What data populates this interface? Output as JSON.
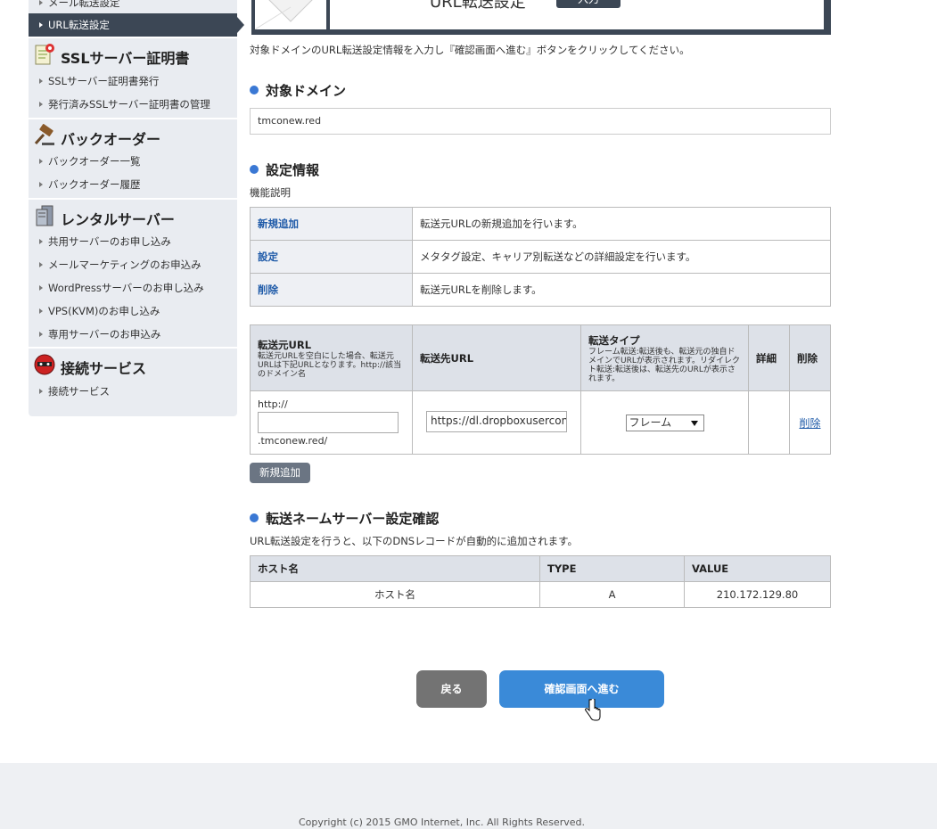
{
  "sidebar": {
    "top_item": "メール転送設定",
    "active_item": "URL転送設定",
    "sections": [
      {
        "title": "SSLサーバー証明書",
        "icon": "certificate-icon",
        "items": [
          "SSLサーバー証明書発行",
          "発行済みSSLサーバー証明書の管理"
        ]
      },
      {
        "title": "バックオーダー",
        "icon": "gavel-icon",
        "items": [
          "バックオーダー一覧",
          "バックオーダー履歴"
        ]
      },
      {
        "title": "レンタルサーバー",
        "icon": "server-icon",
        "items": [
          "共用サーバーのお申し込み",
          "メールマーケティングのお申込み",
          "WordPressサーバーのお申し込み",
          "VPS(KVM)のお申し込み",
          "専用サーバーのお申込み"
        ]
      },
      {
        "title": "接続サービス",
        "icon": "connection-icon",
        "items": [
          "接続サービス"
        ]
      }
    ]
  },
  "header": {
    "title": "URL転送設定",
    "badge": "入力"
  },
  "intro": "対象ドメインのURL転送設定情報を入力し『確認画面へ進む』ボタンをクリックしてください。",
  "domain_section": {
    "heading": "対象ドメイン",
    "value": "tmconew.red"
  },
  "settings_section": {
    "heading": "設定情報",
    "sub": "機能説明",
    "functions": [
      {
        "key": "新規追加",
        "desc": "転送元URLの新規追加を行います。"
      },
      {
        "key": "設定",
        "desc": "メタタグ設定、キャリア別転送などの詳細設定を行います。"
      },
      {
        "key": "削除",
        "desc": "転送元URLを削除します。"
      }
    ]
  },
  "url_table": {
    "col_source": "転送元URL",
    "col_source_note": "転送元URLを空白にした場合、転送元URLは下記URLとなります。http://該当のドメイン名",
    "col_dest": "転送先URL",
    "col_type": "転送タイプ",
    "col_type_note": "フレーム転送:転送後も、転送元の独自ドメインでURLが表示されます。リダイレクト転送:転送後は、転送先のURLが表示されます。",
    "col_detail": "詳細",
    "col_delete": "削除",
    "row": {
      "prefix": "http://",
      "source_value": "",
      "suffix": ".tmconew.red/",
      "dest_value": "https://dl.dropboxuserconte",
      "type_value": "フレーム",
      "detail": "",
      "delete_link": "削除"
    }
  },
  "add_button": "新規追加",
  "dns_section": {
    "heading": "転送ネームサーバー設定確認",
    "desc": "URL転送設定を行うと、以下のDNSレコードが自動的に追加されます。",
    "headers": [
      "ホスト名",
      "TYPE",
      "VALUE"
    ],
    "row": [
      "ホスト名",
      "A",
      "210.172.129.80"
    ]
  },
  "buttons": {
    "back": "戻る",
    "next": "確認画面へ進む"
  },
  "footer": {
    "copyright": "Copyright (c) 2015 GMO Internet, Inc. All Rights Reserved."
  },
  "colors": {
    "accent": "#3a8ad8",
    "dark": "#3c4755",
    "dot": "#3a78d4"
  }
}
